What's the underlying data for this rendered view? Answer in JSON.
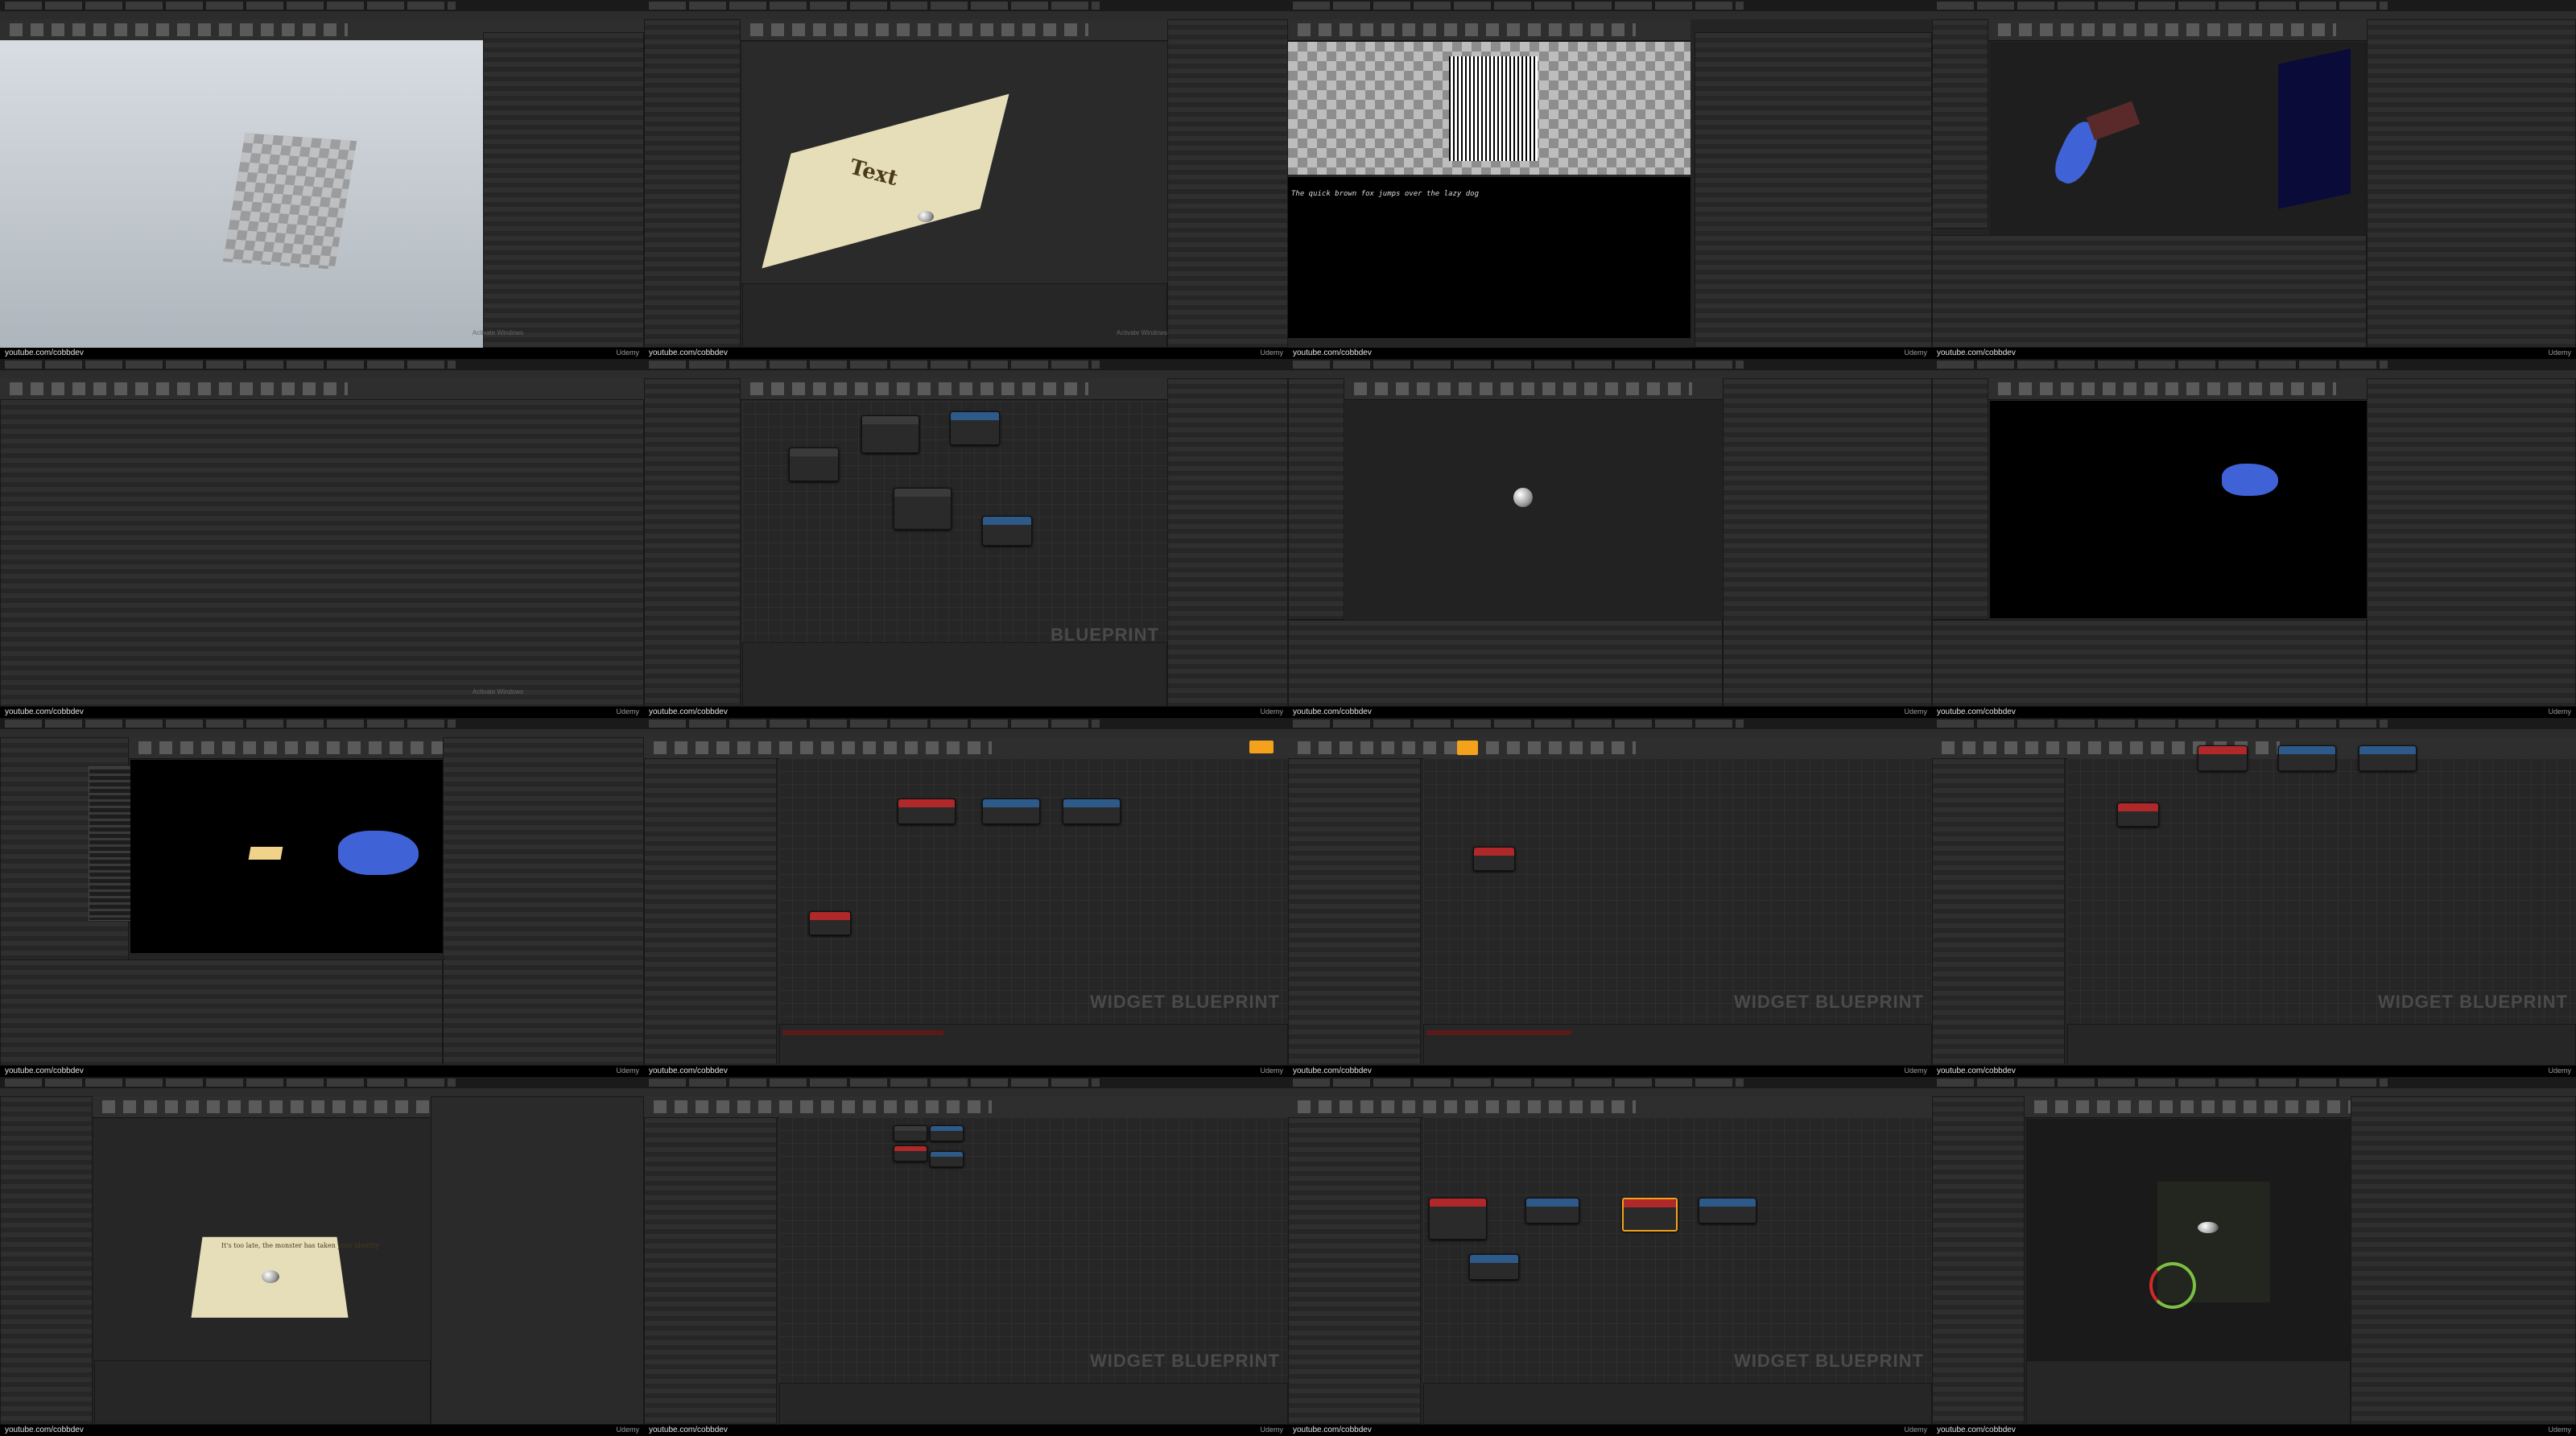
{
  "footer": {
    "channel": "youtube.com/cobbdev",
    "brand": "Udemy"
  },
  "activate_windows": "Activate Windows",
  "watermarks": {
    "blueprint": "BLUEPRINT",
    "widget_blueprint": "WIDGET BLUEPRINT"
  },
  "viewport_texts": {
    "text_render": "Text",
    "preview_sentence": "The quick brown fox jumps over the lazy dog",
    "plane_note": "It's too late, the monster has taken your identity"
  },
  "colors": {
    "orange": "#f4a11b",
    "blue_object": "#3f63d6",
    "node_red": "#b0282a",
    "node_blue": "#2e5a8a"
  }
}
